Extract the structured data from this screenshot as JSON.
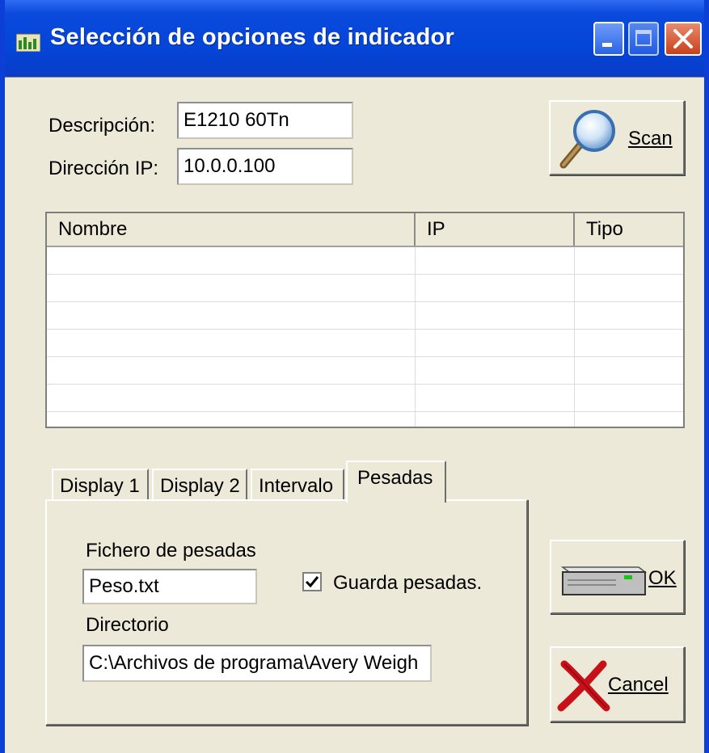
{
  "window": {
    "title": "Selección de opciones de indicador"
  },
  "form": {
    "descripcion_label": "Descripción:",
    "descripcion_value": "E1210 60Tn",
    "ip_label": "Dirección IP:",
    "ip_value": "10.0.0.100"
  },
  "scan_button": {
    "label": "Scan"
  },
  "list": {
    "columns": [
      "Nombre",
      "IP",
      "Tipo"
    ],
    "rows": []
  },
  "tabs": [
    {
      "label": "Display 1",
      "active": false
    },
    {
      "label": "Display 2",
      "active": false
    },
    {
      "label": "Intervalo",
      "active": false
    },
    {
      "label": "Pesadas",
      "active": true
    }
  ],
  "pesadas": {
    "fichero_label": "Fichero de pesadas",
    "fichero_value": "Peso.txt",
    "guarda_label": "Guarda pesadas.",
    "guarda_checked": true,
    "directorio_label": "Directorio",
    "directorio_value": "C:\\Archivos de programa\\Avery Weigh"
  },
  "ok_button": {
    "label": "OK"
  },
  "cancel_button": {
    "label": "Cancel"
  },
  "colors": {
    "titlebar": "#0446d8",
    "window_face": "#ece9d8",
    "cancel_x": "#c8101a"
  }
}
